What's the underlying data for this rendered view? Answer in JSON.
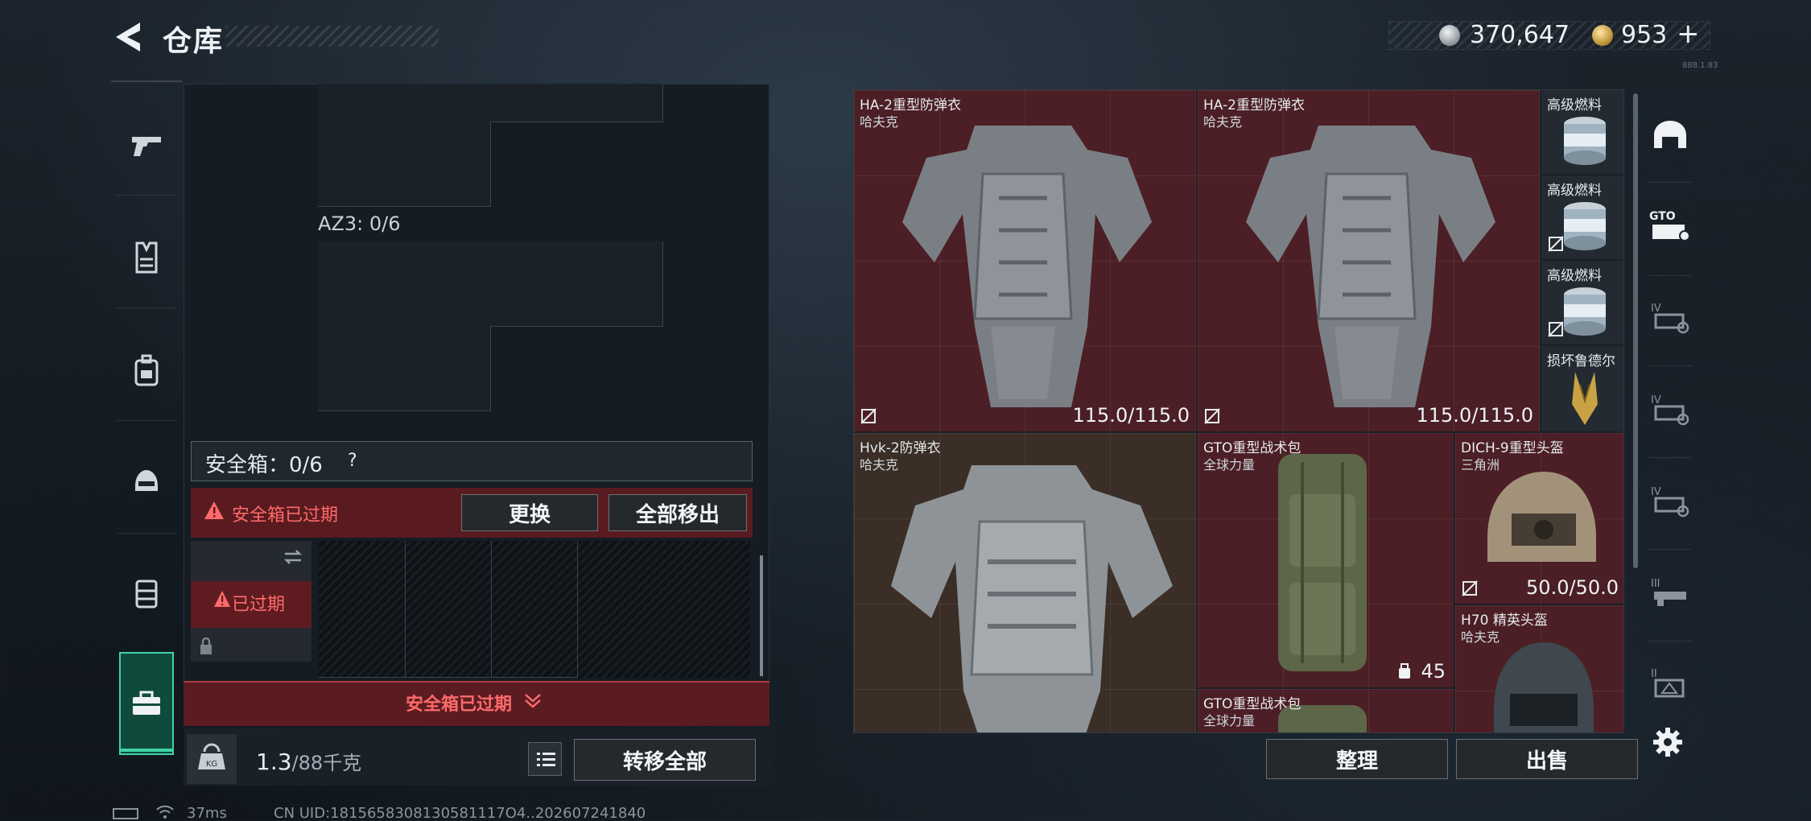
{
  "header": {
    "title": "仓库",
    "silver_amount": "370,647",
    "gold_amount": "953",
    "gold_plus": "+",
    "corner_code": "888.1.83"
  },
  "left_nav": {
    "items": [
      "pistol-icon",
      "vest-icon",
      "backpack-icon",
      "helmet-icon",
      "rig-icon",
      "case-icon"
    ],
    "active": "case-icon"
  },
  "left_panel": {
    "az3_label": "AZ3: 0/6",
    "safebox_label": "安全箱：0/6",
    "safebox_help": "?",
    "expired_text": "安全箱已过期",
    "replace_label": "更换",
    "remove_all_label": "全部移出",
    "case_expired_text": "已过期",
    "footer_expired_text": "安全箱已过期",
    "weight_value": "1.3",
    "weight_max": "/88千克",
    "transfer_all_label": "转移全部"
  },
  "inventory": {
    "items": [
      {
        "name": "HA-2重型防弹衣",
        "brand": "哈夫克",
        "durability": "115.0/115.0"
      },
      {
        "name": "HA-2重型防弹衣",
        "brand": "哈夫克",
        "durability": "115.0/115.0"
      },
      {
        "name": "高级燃料"
      },
      {
        "name": "高级燃料"
      },
      {
        "name": "高级燃料"
      },
      {
        "name": "损坏鲁德尔"
      },
      {
        "name": "Hvk-2防弹衣",
        "brand": "哈夫克"
      },
      {
        "name": "GTO重型战术包",
        "brand": "全球力量",
        "count": "45"
      },
      {
        "name": "DICH-9重型头盔",
        "brand": "三角洲",
        "durability": "50.0/50.0"
      },
      {
        "name": "H70 精英头盔",
        "brand": "哈夫克"
      },
      {
        "name": "GTO重型战术包",
        "brand": "全球力量"
      }
    ],
    "sort_label": "整理",
    "sell_label": "出售"
  },
  "right_filter": {
    "items": [
      "helmet-filter-icon",
      "gto-bag-filter-icon",
      "tier4-filter-icon",
      "tier4-filter-icon",
      "tier4-filter-icon",
      "tier3-filter-icon",
      "tier2-filter-icon"
    ]
  },
  "status_bar": {
    "ping": "37ms",
    "uid": "CN UID:1815658308130581117O4..202607241840"
  },
  "colors": {
    "accent_green": "#3fd3a6",
    "expired_red": "#ff6a6a",
    "item_red_bg": "#4b1f25"
  }
}
